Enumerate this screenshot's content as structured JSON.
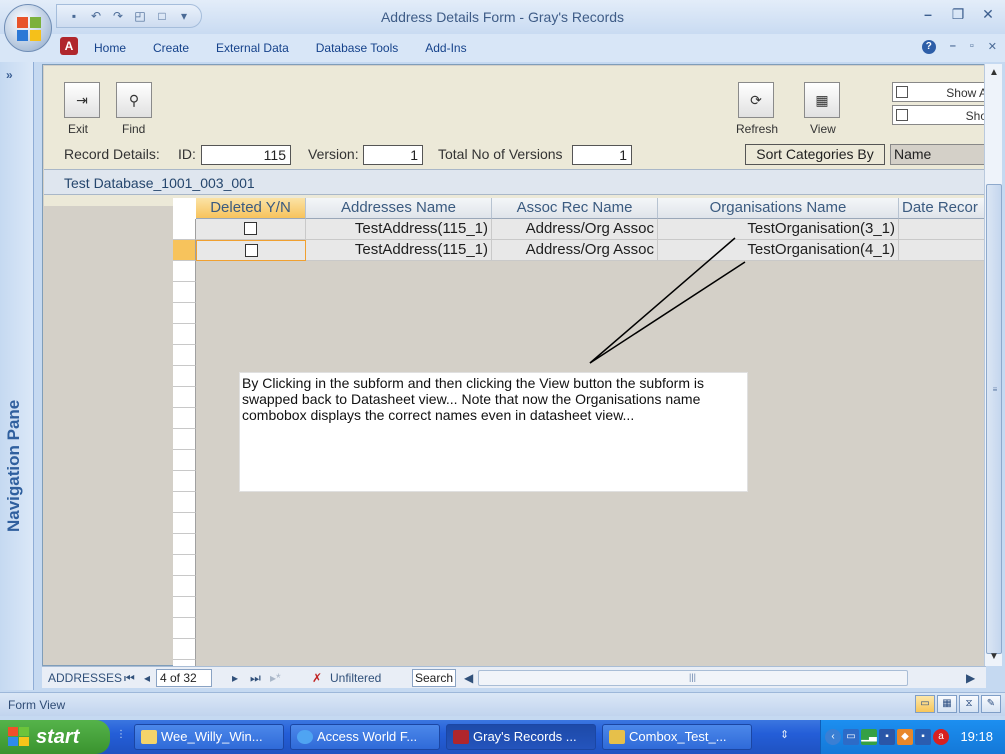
{
  "window": {
    "title": "Address Details Form - Gray's Records"
  },
  "ribbon": {
    "tabs": [
      "Home",
      "Create",
      "External Data",
      "Database Tools",
      "Add-Ins"
    ]
  },
  "nav_pane": {
    "label": "Navigation Pane",
    "expand_glyph": "»"
  },
  "form": {
    "buttons": {
      "exit": "Exit",
      "find": "Find",
      "refresh": "Refresh",
      "view": "View"
    },
    "checkboxes": [
      "Show A",
      "Sho"
    ],
    "record_details_label": "Record Details:",
    "id_label": "ID:",
    "id_value": "115",
    "version_label": "Version:",
    "version_value": "1",
    "total_versions_label": "Total No of Versions",
    "total_versions_value": "1",
    "sort_button": "Sort Categories By",
    "sort_value": "Name",
    "db_label": "Test Database_1001_003_001"
  },
  "datasheet": {
    "columns": [
      "Deleted Y/N",
      "Addresses Name",
      "Assoc Rec Name",
      "Organisations Name",
      "Date Recor"
    ],
    "rows": [
      {
        "deleted": false,
        "address": "TestAddress(115_1)",
        "assoc": "Address/Org Assoc",
        "org": "TestOrganisation(3_1)",
        "date": ""
      },
      {
        "deleted": false,
        "address": "TestAddress(115_1)",
        "assoc": "Address/Org Assoc",
        "org": "TestOrganisation(4_1)",
        "date": ""
      }
    ]
  },
  "callout": {
    "text": "By Clicking in the subform and then clicking the View button the subform is swapped back to Datasheet view... Note that now the Organisations name combobox displays the correct names even in datasheet view..."
  },
  "record_nav": {
    "table_label": "ADDRESSES",
    "position": "4 of 32",
    "filter_label": "Unfiltered",
    "search_label": "Search"
  },
  "status_bar": {
    "text": "Form View"
  },
  "taskbar": {
    "start_label": "start",
    "tasks": [
      "Wee_Willy_Win...",
      "Access World F...",
      "Gray's Records ...",
      "Combox_Test_..."
    ],
    "clock": "19:18"
  },
  "colors": {
    "access_red": "#b0262c",
    "taskbar_blue": "#245ed8",
    "start_green": "#3a932f"
  }
}
